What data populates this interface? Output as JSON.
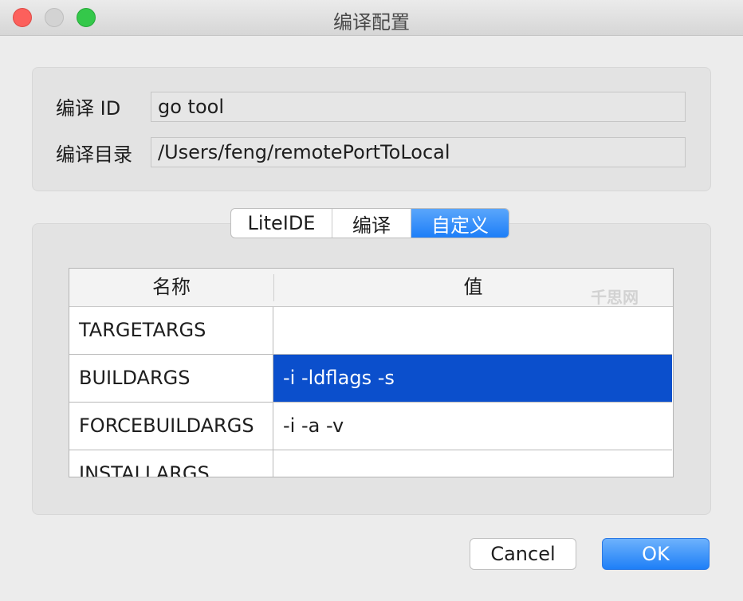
{
  "window": {
    "title": "编译配置"
  },
  "form": {
    "build_id_label": "编译 ID",
    "build_id_value": "go tool",
    "build_dir_label": "编译目录",
    "build_dir_value": "/Users/feng/remotePortToLocal"
  },
  "tabs": [
    {
      "label": "LiteIDE",
      "selected": false
    },
    {
      "label": "编译",
      "selected": false
    },
    {
      "label": "自定义",
      "selected": true
    }
  ],
  "table": {
    "headers": [
      "名称",
      "值"
    ],
    "rows": [
      {
        "name": "TARGETARGS",
        "value": "",
        "selected": false
      },
      {
        "name": "BUILDARGS",
        "value": "-i -ldflags -s",
        "selected": true
      },
      {
        "name": "FORCEBUILDARGS",
        "value": "-i -a -v",
        "selected": false
      },
      {
        "name": "INSTALLARGS",
        "value": "",
        "selected": false
      }
    ]
  },
  "watermark": "千思网",
  "buttons": {
    "cancel": "Cancel",
    "ok": "OK"
  },
  "colors": {
    "accent": "#1d7ef8",
    "selection": "#0b4fcc",
    "close": "#fc605c",
    "zoom": "#34c84a"
  }
}
